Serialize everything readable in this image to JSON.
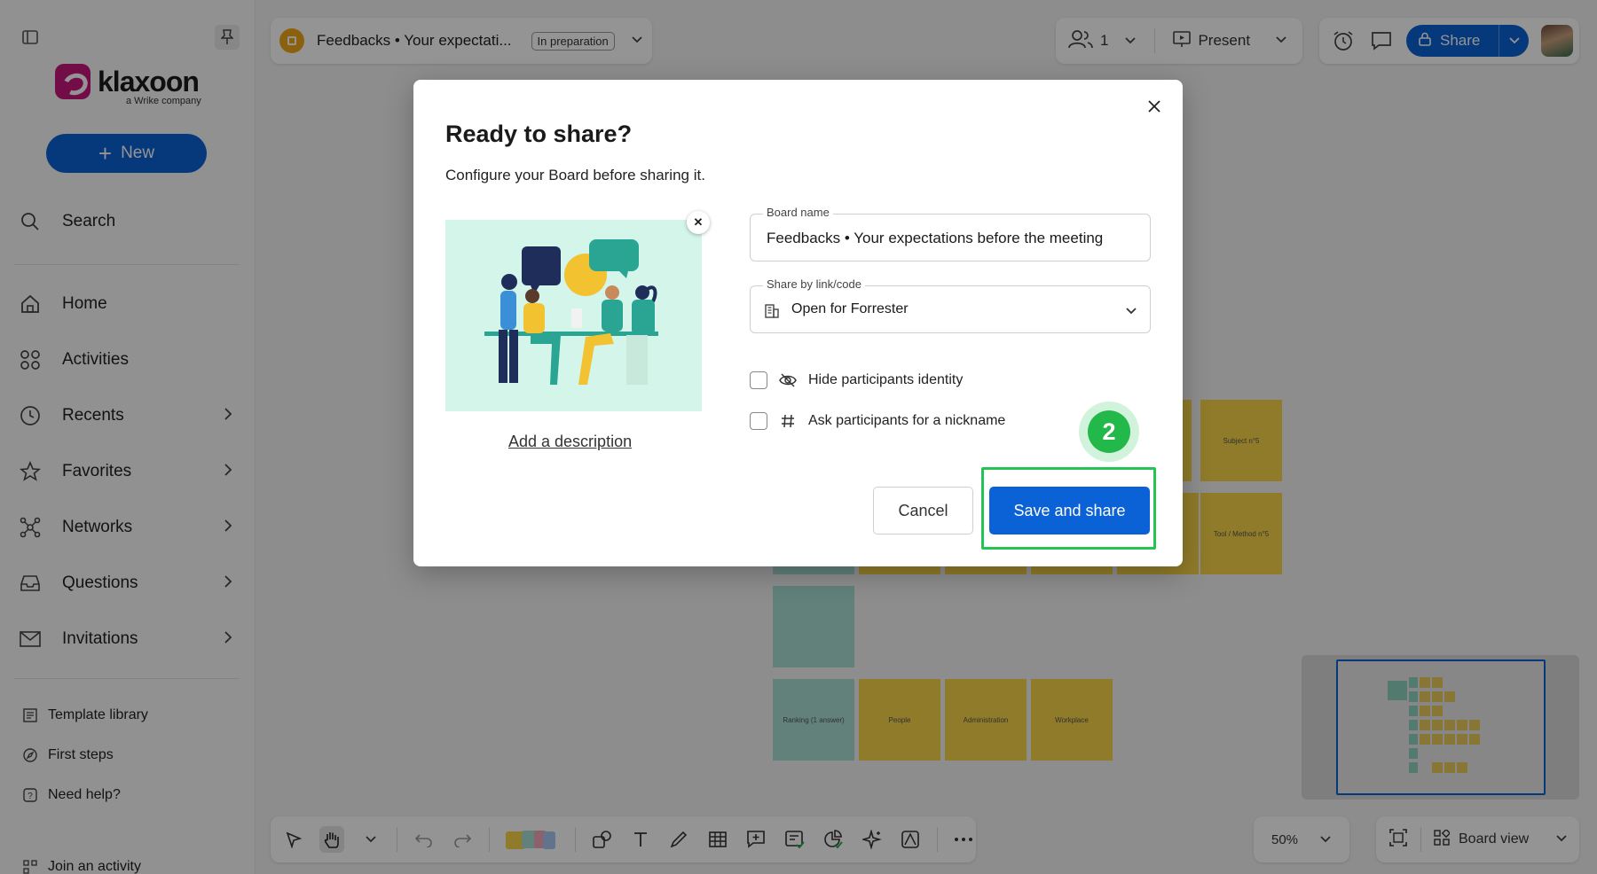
{
  "sidebar": {
    "logo_text": "klaxoon",
    "logo_subtitle": "a Wrike company",
    "new_label": "New",
    "search_label": "Search",
    "items": [
      {
        "label": "Home",
        "icon": "home-icon"
      },
      {
        "label": "Activities",
        "icon": "activities-icon"
      },
      {
        "label": "Recents",
        "icon": "clock-icon"
      },
      {
        "label": "Favorites",
        "icon": "star-icon"
      },
      {
        "label": "Networks",
        "icon": "network-icon"
      },
      {
        "label": "Questions",
        "icon": "inbox-icon"
      },
      {
        "label": "Invitations",
        "icon": "mail-icon"
      }
    ],
    "footer_links": [
      {
        "label": "Template library",
        "icon": "template-icon"
      },
      {
        "label": "First steps",
        "icon": "compass-icon"
      },
      {
        "label": "Need help?",
        "icon": "help-icon"
      },
      {
        "label": "Join an activity",
        "icon": "qr-icon"
      }
    ]
  },
  "header": {
    "board_title": "Feedbacks • Your expectati...",
    "status_badge": "In preparation",
    "participants_count": "1",
    "present_label": "Present",
    "share_label": "Share"
  },
  "toolbar": {
    "zoom_level": "50%",
    "view_label": "Board view"
  },
  "board_stickies": {
    "subject": "Subject n°5",
    "tool": "Tool / Method n°5",
    "ranking": "Ranking (1 answer)",
    "people": "People",
    "administration": "Administration",
    "workplace": "Workplace"
  },
  "modal": {
    "title": "Ready to share?",
    "subtitle": "Configure your Board before sharing it.",
    "add_description": "Add a description",
    "board_name_label": "Board name",
    "board_name_value": "Feedbacks • Your expectations before the meeting",
    "share_label": "Share by link/code",
    "share_value": "Open for Forrester",
    "option_hide_identity": "Hide participants identity",
    "option_nickname": "Ask participants for a nickname",
    "step_number": "2",
    "cancel_label": "Cancel",
    "save_label": "Save and share"
  },
  "colors": {
    "accent": "#0a62d6",
    "highlight": "#24c452",
    "sticky_yellow": "#f6d548",
    "sticky_teal": "#a8dfd2"
  }
}
